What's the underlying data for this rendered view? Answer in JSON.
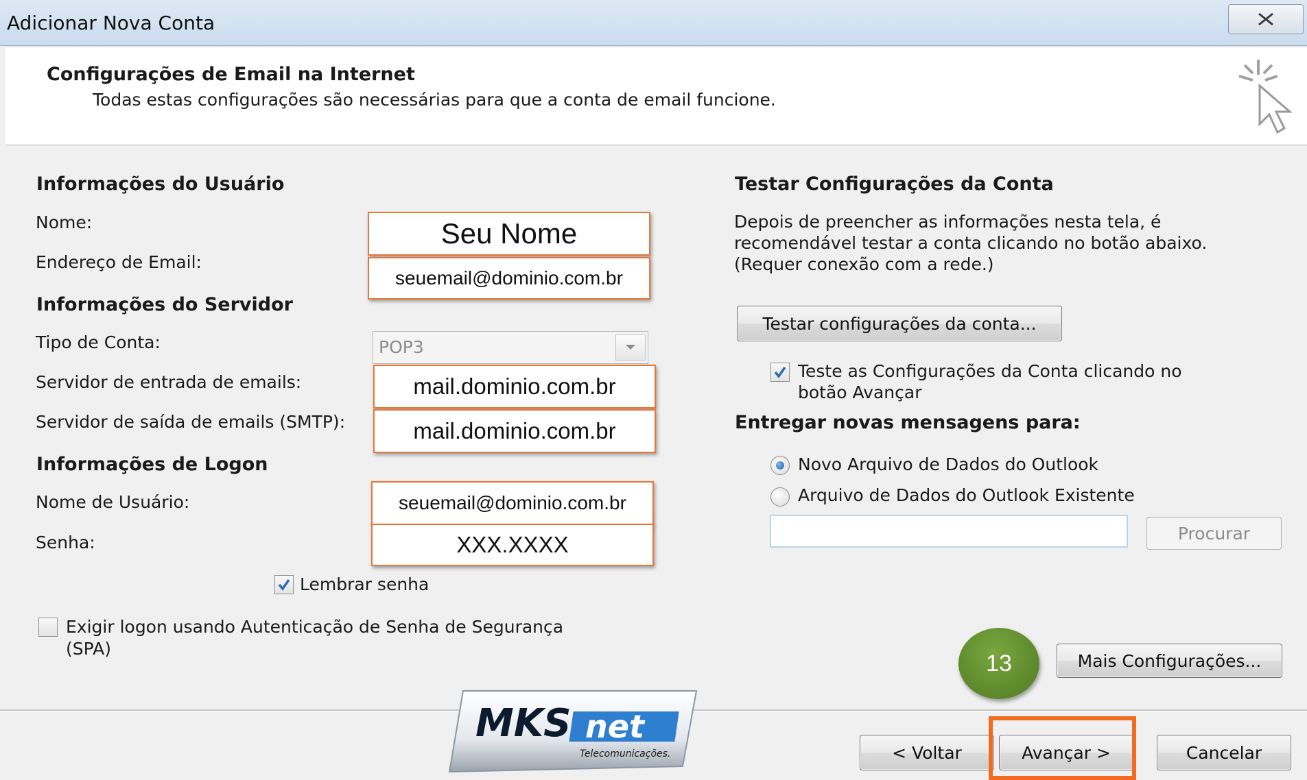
{
  "window": {
    "title": "Adicionar Nova Conta",
    "close_icon": "close-icon"
  },
  "header": {
    "title": "Configurações de Email na Internet",
    "subtitle": "Todas estas configurações são necessárias para que a conta de email funcione."
  },
  "user_info": {
    "heading": "Informações do Usuário",
    "name_label": "Nome:",
    "name_value": "Seu Nome",
    "email_label": "Endereço de Email:",
    "email_value": "seuemail@dominio.com.br"
  },
  "server_info": {
    "heading": "Informações do Servidor",
    "account_type_label": "Tipo de Conta:",
    "account_type_value": "POP3",
    "incoming_label": "Servidor de entrada de emails:",
    "incoming_value": "mail.dominio.com.br",
    "outgoing_label": "Servidor de saída de emails (SMTP):",
    "outgoing_value": "mail.dominio.com.br"
  },
  "logon_info": {
    "heading": "Informações de Logon",
    "username_label": "Nome de Usuário:",
    "username_value": "seuemail@dominio.com.br",
    "password_label": "Senha:",
    "password_value": "XXX.XXXX",
    "remember_label": "Lembrar senha",
    "remember_checked": true,
    "spa_label_line1": "Exigir logon usando Autenticação de Senha de Segurança",
    "spa_label_line2": "(SPA)",
    "spa_checked": false
  },
  "test_settings": {
    "heading": "Testar Configurações da Conta",
    "desc_line1": "Depois de preencher as informações nesta tela, é",
    "desc_line2": "recomendável testar a conta clicando no botão abaixo.",
    "desc_line3": "(Requer conexão com a rede.)",
    "test_button": "Testar configurações da conta...",
    "auto_test_line1": "Teste as Configurações da Conta clicando no",
    "auto_test_line2": "botão Avançar",
    "auto_test_checked": true
  },
  "deliver": {
    "heading": "Entregar novas mensagens para:",
    "option_new": "Novo Arquivo de Dados do Outlook",
    "option_existing": "Arquivo de Dados do Outlook Existente",
    "selected": "option_new",
    "path_value": "",
    "browse_button": "Procurar"
  },
  "more_settings_button": "Mais Configurações...",
  "step_number": "13",
  "footer": {
    "back_button": "< Voltar",
    "next_button": "Avançar >",
    "cancel_button": "Cancelar"
  },
  "logo": {
    "brand_main": "MKS",
    "brand_accent": "net",
    "tagline": "Telecomunicações."
  },
  "colors": {
    "highlight_border": "#e8783a",
    "step_circle": "#5e8a2c",
    "next_outline": "#f26b21",
    "checkbox_tick": "#2b6bb5"
  }
}
